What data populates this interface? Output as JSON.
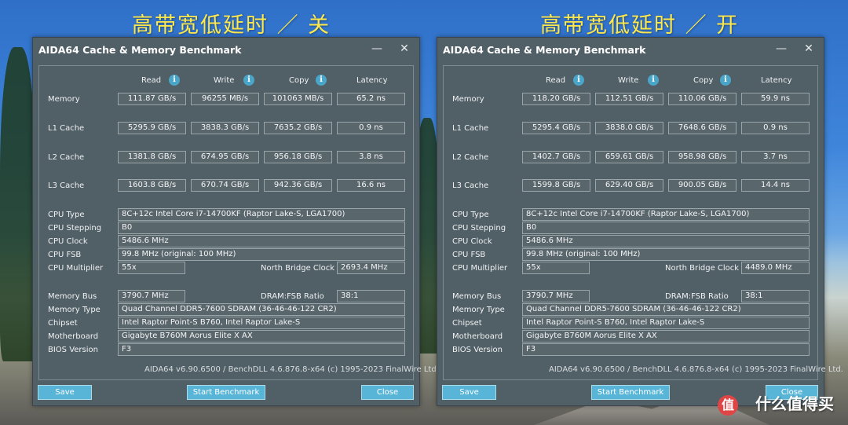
{
  "captions": {
    "left": "高带宽低延时 ／ 关",
    "right": "高带宽低延时 ／ 开"
  },
  "watermark": "什么值得买",
  "windows": [
    {
      "id": "left",
      "title": "AIDA64 Cache & Memory Benchmark",
      "minimize_icon": "minimize-icon",
      "close_icon": "close-icon",
      "headers": {
        "read": "Read",
        "write": "Write",
        "copy": "Copy",
        "latency": "Latency"
      },
      "info_icon": "info-icon",
      "rows": [
        {
          "label": "Memory",
          "read": "111.87 GB/s",
          "write": "96255 MB/s",
          "copy": "101063 MB/s",
          "latency": "65.2 ns"
        },
        {
          "label": "L1 Cache",
          "read": "5295.9 GB/s",
          "write": "3838.3 GB/s",
          "copy": "7635.2 GB/s",
          "latency": "0.9 ns"
        },
        {
          "label": "L2 Cache",
          "read": "1381.8 GB/s",
          "write": "674.95 GB/s",
          "copy": "956.18 GB/s",
          "latency": "3.8 ns"
        },
        {
          "label": "L3 Cache",
          "read": "1603.8 GB/s",
          "write": "670.74 GB/s",
          "copy": "942.36 GB/s",
          "latency": "16.6 ns"
        }
      ],
      "info": {
        "cpu_type_label": "CPU Type",
        "cpu_type": "8C+12c Intel Core i7-14700KF  (Raptor Lake-S, LGA1700)",
        "cpu_stepping_label": "CPU Stepping",
        "cpu_stepping": "B0",
        "cpu_clock_label": "CPU Clock",
        "cpu_clock": "5486.6 MHz",
        "cpu_fsb_label": "CPU FSB",
        "cpu_fsb": "99.8 MHz  (original: 100 MHz)",
        "cpu_multiplier_label": "CPU Multiplier",
        "cpu_multiplier": "55x",
        "nb_clock_label": "North Bridge Clock",
        "nb_clock": "2693.4 MHz",
        "memory_bus_label": "Memory Bus",
        "memory_bus": "3790.7 MHz",
        "dram_fsb_label": "DRAM:FSB Ratio",
        "dram_fsb": "38:1",
        "memory_type_label": "Memory Type",
        "memory_type": "Quad Channel DDR5-7600 SDRAM  (36-46-46-122 CR2)",
        "chipset_label": "Chipset",
        "chipset": "Intel Raptor Point-S B760, Intel Raptor Lake-S",
        "motherboard_label": "Motherboard",
        "motherboard": "Gigabyte B760M Aorus Elite X AX",
        "bios_label": "BIOS Version",
        "bios": "F3"
      },
      "footer": "AIDA64 v6.90.6500 / BenchDLL 4.6.876.8-x64  (c) 1995-2023 FinalWire Ltd.",
      "buttons": {
        "save": "Save",
        "start": "Start Benchmark",
        "close": "Close"
      }
    },
    {
      "id": "right",
      "title": "AIDA64 Cache & Memory Benchmark",
      "minimize_icon": "minimize-icon",
      "close_icon": "close-icon",
      "headers": {
        "read": "Read",
        "write": "Write",
        "copy": "Copy",
        "latency": "Latency"
      },
      "info_icon": "info-icon",
      "rows": [
        {
          "label": "Memory",
          "read": "118.20 GB/s",
          "write": "112.51 GB/s",
          "copy": "110.06 GB/s",
          "latency": "59.9 ns"
        },
        {
          "label": "L1 Cache",
          "read": "5295.4 GB/s",
          "write": "3838.0 GB/s",
          "copy": "7648.6 GB/s",
          "latency": "0.9 ns"
        },
        {
          "label": "L2 Cache",
          "read": "1402.7 GB/s",
          "write": "659.61 GB/s",
          "copy": "958.98 GB/s",
          "latency": "3.7 ns"
        },
        {
          "label": "L3 Cache",
          "read": "1599.8 GB/s",
          "write": "629.40 GB/s",
          "copy": "900.05 GB/s",
          "latency": "14.4 ns"
        }
      ],
      "info": {
        "cpu_type_label": "CPU Type",
        "cpu_type": "8C+12c Intel Core i7-14700KF  (Raptor Lake-S, LGA1700)",
        "cpu_stepping_label": "CPU Stepping",
        "cpu_stepping": "B0",
        "cpu_clock_label": "CPU Clock",
        "cpu_clock": "5486.6 MHz",
        "cpu_fsb_label": "CPU FSB",
        "cpu_fsb": "99.8 MHz  (original: 100 MHz)",
        "cpu_multiplier_label": "CPU Multiplier",
        "cpu_multiplier": "55x",
        "nb_clock_label": "North Bridge Clock",
        "nb_clock": "4489.0 MHz",
        "memory_bus_label": "Memory Bus",
        "memory_bus": "3790.7 MHz",
        "dram_fsb_label": "DRAM:FSB Ratio",
        "dram_fsb": "38:1",
        "memory_type_label": "Memory Type",
        "memory_type": "Quad Channel DDR5-7600 SDRAM  (36-46-46-122 CR2)",
        "chipset_label": "Chipset",
        "chipset": "Intel Raptor Point-S B760, Intel Raptor Lake-S",
        "motherboard_label": "Motherboard",
        "motherboard": "Gigabyte B760M Aorus Elite X AX",
        "bios_label": "BIOS Version",
        "bios": "F3"
      },
      "footer": "AIDA64 v6.90.6500 / BenchDLL 4.6.876.8-x64  (c) 1995-2023 FinalWire Ltd.",
      "buttons": {
        "save": "Save",
        "start": "Start Benchmark",
        "close": "Close"
      }
    }
  ]
}
